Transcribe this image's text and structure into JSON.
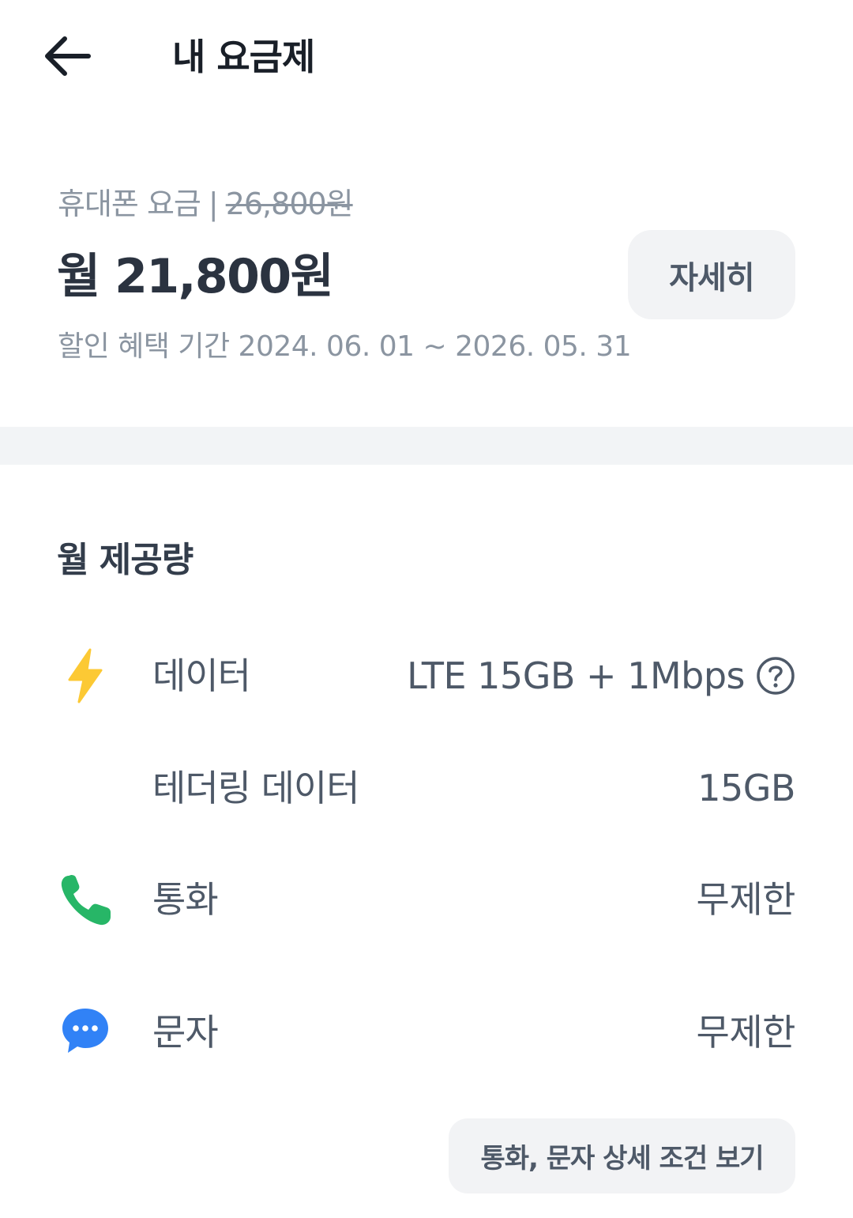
{
  "header": {
    "title": "내 요금제",
    "back_icon": "arrow-left-icon"
  },
  "fee": {
    "label": "휴대폰 요금",
    "separator": "|",
    "original_price": "26,800원",
    "monthly_price": "월 21,800원",
    "discount_period": "할인 혜택 기간 2024. 06. 01 ~ 2026. 05. 31",
    "detail_button": "자세히"
  },
  "allowance": {
    "title": "월 제공량",
    "rows": [
      {
        "icon": "lightning-icon",
        "label": "데이터",
        "value": "LTE 15GB + 1Mbps",
        "help_icon": "question-circle-icon"
      },
      {
        "icon": "",
        "label": "테더링 데이터",
        "value": "15GB"
      },
      {
        "icon": "phone-icon",
        "label": "통화",
        "value": "무제한"
      },
      {
        "icon": "chat-bubble-icon",
        "label": "문자",
        "value": "무제한"
      }
    ],
    "condition_button": "통화, 문자 상세 조건 보기"
  },
  "colors": {
    "lightning": "#fcc934",
    "phone": "#27b667",
    "chat": "#3182f6",
    "divider": "#f2f4f6",
    "button_bg": "#f2f3f5"
  }
}
